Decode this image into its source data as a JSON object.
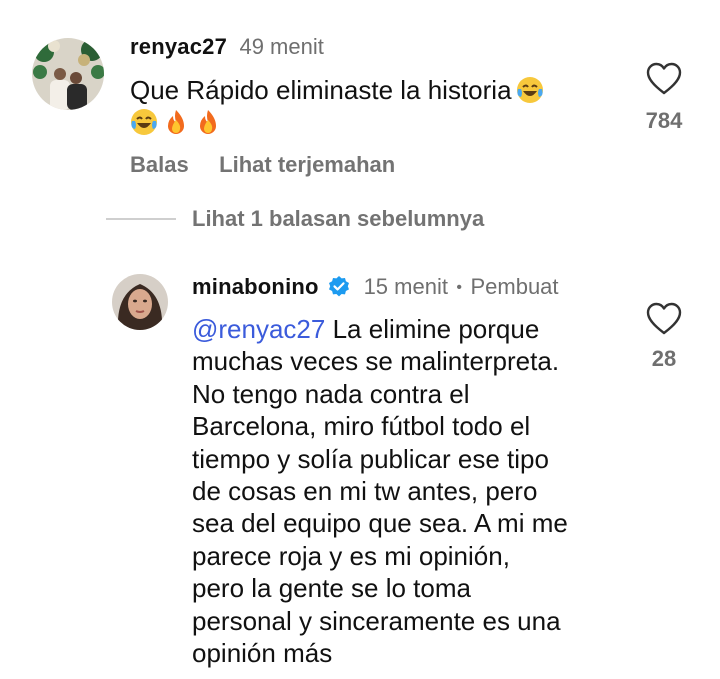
{
  "colors": {
    "mention": "#3b5bdb",
    "muted": "#737373",
    "verified": "#1d9bf0",
    "text": "#111111"
  },
  "comment1": {
    "username": "renyac27",
    "time": "49 menit",
    "text": "Que Rápido eliminaste la historia",
    "emojis": [
      "face-with-tears-of-joy",
      "face-with-tears-of-joy",
      "fire",
      "fire"
    ],
    "likes": "784",
    "reply_label": "Balas",
    "translate_label": "Lihat terjemahan"
  },
  "view_replies": {
    "label": "Lihat 1 balasan sebelumnya"
  },
  "comment2": {
    "username": "minabonino",
    "verified": true,
    "time": "15 menit",
    "separator": "•",
    "role": "Pembuat",
    "mention": "@renyac27",
    "lines": [
      "La elimine porque",
      "muchas veces se malinterpreta.",
      "No tengo nada contra el",
      "Barcelona, miro fútbol todo el",
      "tiempo y solía publicar ese tipo",
      "de cosas en mi tw antes, pero",
      "sea del equipo que sea. A mi me",
      "parece roja y es mi opinión,",
      "pero la gente se lo toma",
      "personal y sinceramente es una",
      "opinión más"
    ],
    "likes": "28"
  }
}
